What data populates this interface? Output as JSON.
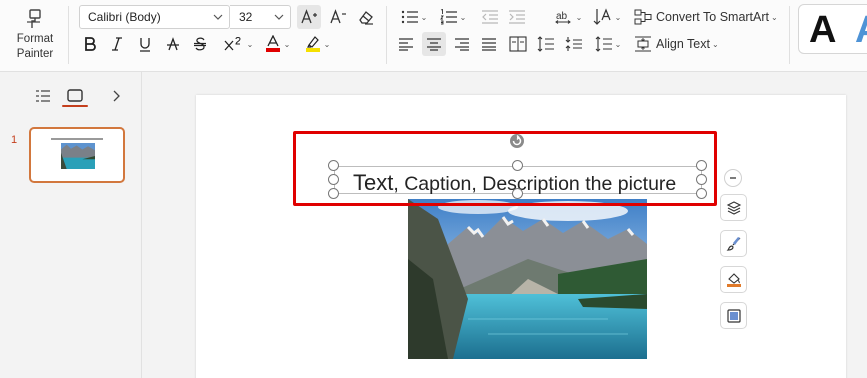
{
  "ribbon": {
    "format_painter": {
      "line1": "Format",
      "line2": "Painter"
    },
    "font": {
      "name": "Calibri (Body)",
      "size": "32"
    },
    "convert_smartart": "Convert To SmartArt",
    "align_text": "Align Text",
    "styles": {
      "sample1": "A",
      "sample2": "A"
    }
  },
  "left_pane": {
    "slide_number": "1"
  },
  "slide": {
    "text_box": {
      "first_word": "Text",
      "rest": ", Caption, Description the picture"
    }
  },
  "colors": {
    "accent": "#c43e1c",
    "highlight_box": "#e00000",
    "font_color": "#e00000",
    "highlight_color": "#f5e000"
  }
}
